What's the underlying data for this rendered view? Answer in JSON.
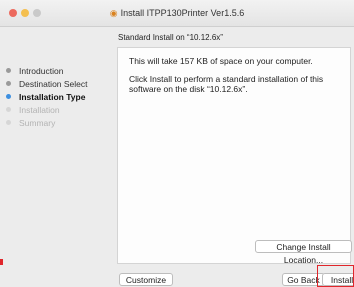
{
  "window": {
    "title": "Install ITPP130Printer Ver1.5.6",
    "title_icon": "package-icon"
  },
  "header": {
    "subtitle": "Standard Install on “10.12.6x”"
  },
  "sidebar": {
    "steps": [
      {
        "label": "Introduction",
        "state": "done"
      },
      {
        "label": "Destination Select",
        "state": "done"
      },
      {
        "label": "Installation Type",
        "state": "current"
      },
      {
        "label": "Installation",
        "state": "pending"
      },
      {
        "label": "Summary",
        "state": "pending"
      }
    ]
  },
  "content": {
    "message1": "This will take 157 KB of space on your computer.",
    "message2": "Click Install to perform a standard installation of this software on the disk “10.12.6x”."
  },
  "buttons": {
    "change_location": "Change Install Location...",
    "customize": "Customize",
    "go_back": "Go Back",
    "install": "Install"
  },
  "colors": {
    "accent": "#3d8fe0",
    "highlight": "#e0262b"
  }
}
